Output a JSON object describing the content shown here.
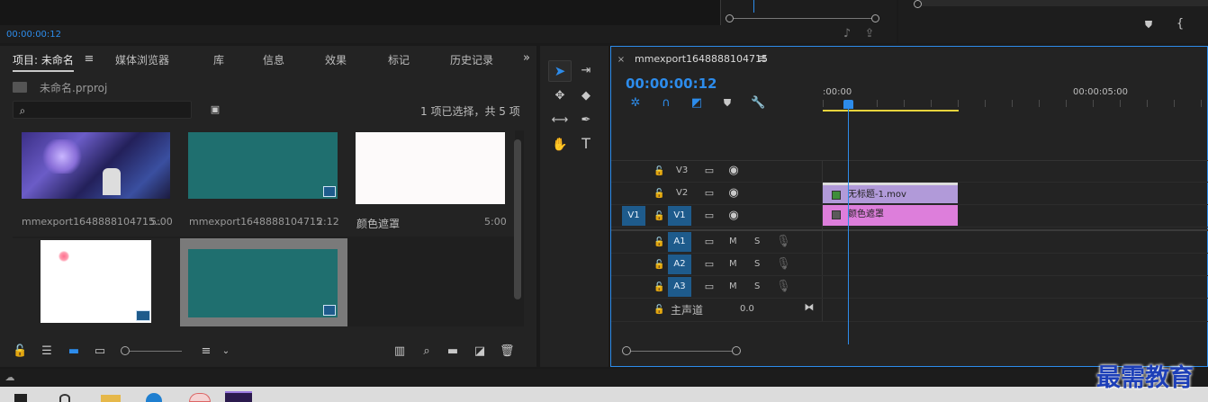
{
  "source_monitor": {
    "timecode": "00:00:00:12"
  },
  "project_panel": {
    "tabs": [
      "项目: 未命名",
      "媒体浏览器",
      "库",
      "信息",
      "效果",
      "标记",
      "历史记录"
    ],
    "project_file": "未命名.prproj",
    "selection_status": "1 项已选择，共 5 项",
    "items": [
      {
        "name": "mmexport1648888104715...",
        "duration": "5:00"
      },
      {
        "name": "mmexport1648888104715",
        "duration": "2:12"
      },
      {
        "name": "颜色遮罩",
        "duration": "5:00"
      },
      {
        "name": "",
        "duration": ""
      },
      {
        "name": "",
        "duration": ""
      }
    ]
  },
  "timeline": {
    "sequence_name": "mmexport1648888104715",
    "timecode": "00:00:00:12",
    "ruler": {
      "start": ":00:00",
      "mark": "00:00:05:00"
    },
    "video_tracks": [
      "V3",
      "V2",
      "V1"
    ],
    "source_patch": "V1",
    "audio_tracks": [
      "A1",
      "A2",
      "A3"
    ],
    "audio_buttons": {
      "mute": "M",
      "solo": "S"
    },
    "master": {
      "label": "主声道",
      "value": "0.0"
    },
    "clips": {
      "v2": "无标题-1.mov",
      "v1": "颜色遮罩"
    }
  },
  "watermark": "最需教育",
  "colors": {
    "accent": "#2d8ceb",
    "teal": "#1f6f6f",
    "v2_clip": "#b19ad9",
    "v1_clip": "#dd7edb",
    "work_area": "#e6d33c"
  }
}
